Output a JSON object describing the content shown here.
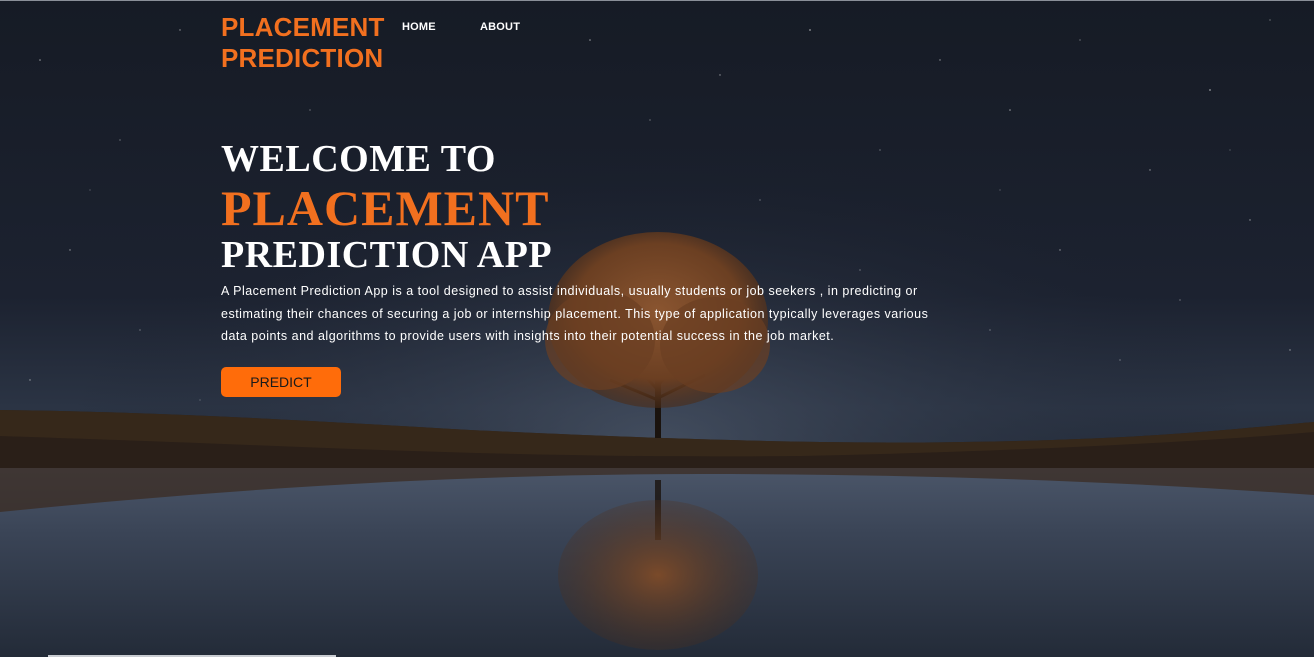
{
  "header": {
    "logo_line1": "PLACEMENT",
    "logo_line2": "PREDICTION",
    "nav": {
      "home": "HOME",
      "about": "ABOUT"
    }
  },
  "hero": {
    "line1": "WELCOME TO",
    "line2": "PLACEMENT",
    "line3": "PREDICTION APP",
    "description": "A Placement Prediction App is a tool designed to assist individuals, usually students or job seekers , in predicting or estimating their chances of securing a job or internship placement. This type of application typically leverages various data points and algorithms to provide users with insights into their potential success in the job market.",
    "button_label": "PREDICT"
  },
  "colors": {
    "accent": "#f2701f",
    "button": "#ff6c0a",
    "text": "#ffffff",
    "background": "#1c2230"
  },
  "background_image": {
    "icon": "night-sky-tree-lake-photo"
  }
}
